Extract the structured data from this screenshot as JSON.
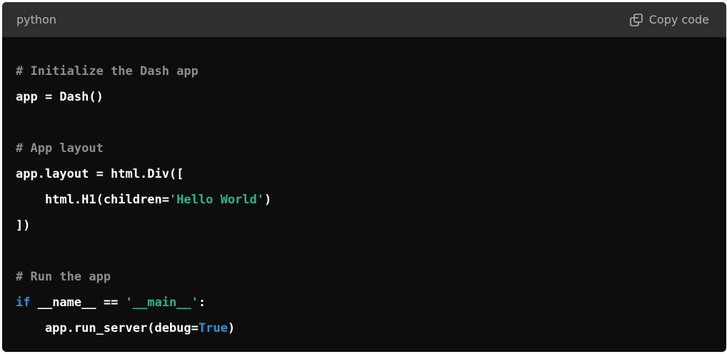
{
  "header": {
    "language": "python",
    "copy_label": "Copy code"
  },
  "code": {
    "line1": "# Initialize the Dash app",
    "line2": "app = Dash()",
    "line4": "# App layout",
    "line5": "app.layout = html.Div([",
    "line6_pre": "    html.H1(children=",
    "line6_str": "'Hello World'",
    "line6_post": ")",
    "line7": "])",
    "line9": "# Run the app",
    "line10_kw": "if",
    "line10_mid": " __name__ == ",
    "line10_str": "'__main__'",
    "line10_post": ":",
    "line11_pre": "    app.run_server(debug=",
    "line11_kw": "True",
    "line11_post": ")"
  },
  "colors": {
    "background": "#0d0d0d",
    "header": "#2f2f2f",
    "comment": "#8d8d8d",
    "string": "#2fb38a",
    "keyword": "#2e95d3",
    "text": "#ffffff"
  }
}
